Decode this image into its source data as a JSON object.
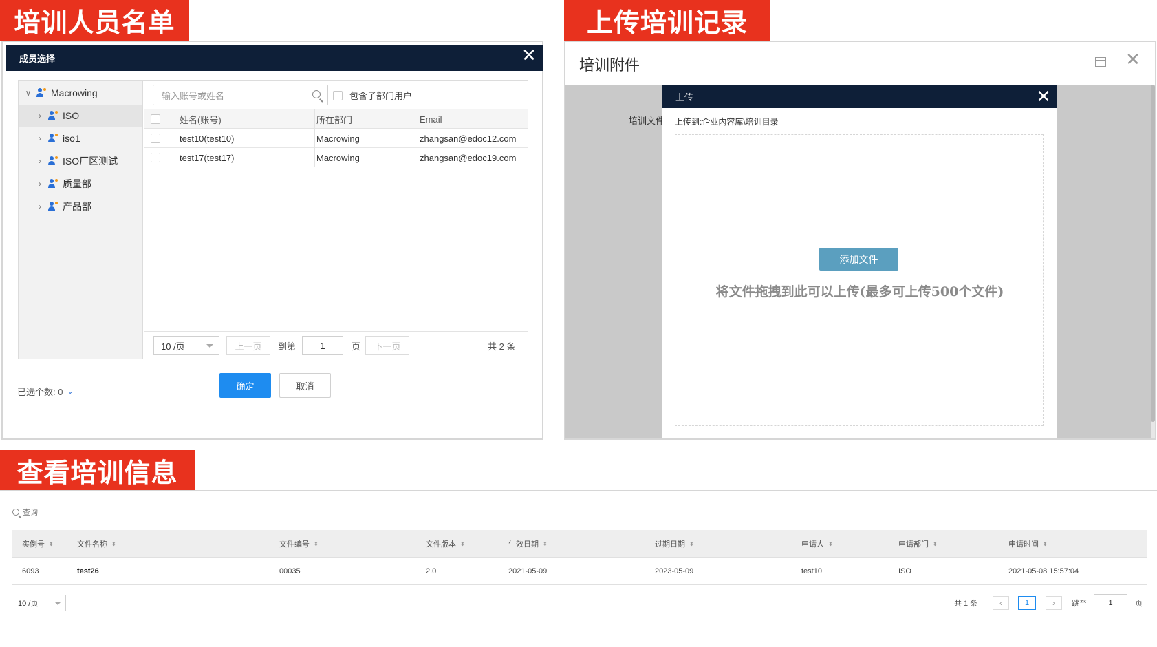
{
  "tags": {
    "members": "培训人员名单",
    "upload": "上传培训记录",
    "view": "查看培训信息"
  },
  "member_select": {
    "title": "成员选择",
    "close_glyph": "✕",
    "tree": [
      {
        "label": "Macrowing",
        "expanded": true,
        "chevron": "∨"
      },
      {
        "label": "ISO",
        "chevron": "›"
      },
      {
        "label": "iso1",
        "chevron": "›"
      },
      {
        "label": "ISO厂区测试",
        "chevron": "›"
      },
      {
        "label": "质量部",
        "chevron": "›"
      },
      {
        "label": "产品部",
        "chevron": "›"
      }
    ],
    "search_placeholder": "输入账号或姓名",
    "include_sub_label": "包含子部门用户",
    "columns": [
      "姓名(账号)",
      "所在部门",
      "Email"
    ],
    "rows": [
      {
        "name": "test10(test10)",
        "dept": "Macrowing",
        "email": "zhangsan@edoc12.com"
      },
      {
        "name": "test17(test17)",
        "dept": "Macrowing",
        "email": "zhangsan@edoc19.com"
      }
    ],
    "pager": {
      "page_size": "10 /页",
      "prev": "上一页",
      "goto": "到第",
      "page_value": "1",
      "page_unit": "页",
      "next": "下一页",
      "total": "共 2 条"
    },
    "selected_label": "已选个数: 0",
    "selected_caret": "⌄",
    "ok": "确定",
    "cancel": "取消"
  },
  "upload": {
    "title": "培训附件",
    "label": "培训文件",
    "dialog_title": "上传",
    "close_glyph": "✕",
    "path": "上传到:企业内容库\\培训目录",
    "add_button": "添加文件",
    "hint": "将文件拖拽到此可以上传(最多可上传500个文件)"
  },
  "view": {
    "search_label": "查询",
    "sort_glyph": "⬍",
    "columns": [
      "实例号",
      "文件名称",
      "文件编号",
      "文件版本",
      "生效日期",
      "过期日期",
      "申请人",
      "申请部门",
      "申请时间"
    ],
    "row": [
      "6093",
      "test26",
      "00035",
      "2.0",
      "2021-05-09",
      "2023-05-09",
      "test10",
      "ISO",
      "2021-05-08 15:57:04"
    ],
    "pager": {
      "page_size": "10 /页",
      "total": "共 1 条",
      "prev_glyph": "‹",
      "current": "1",
      "next_glyph": "›",
      "jump": "跳至",
      "jump_value": "1",
      "page_unit": "页"
    }
  }
}
